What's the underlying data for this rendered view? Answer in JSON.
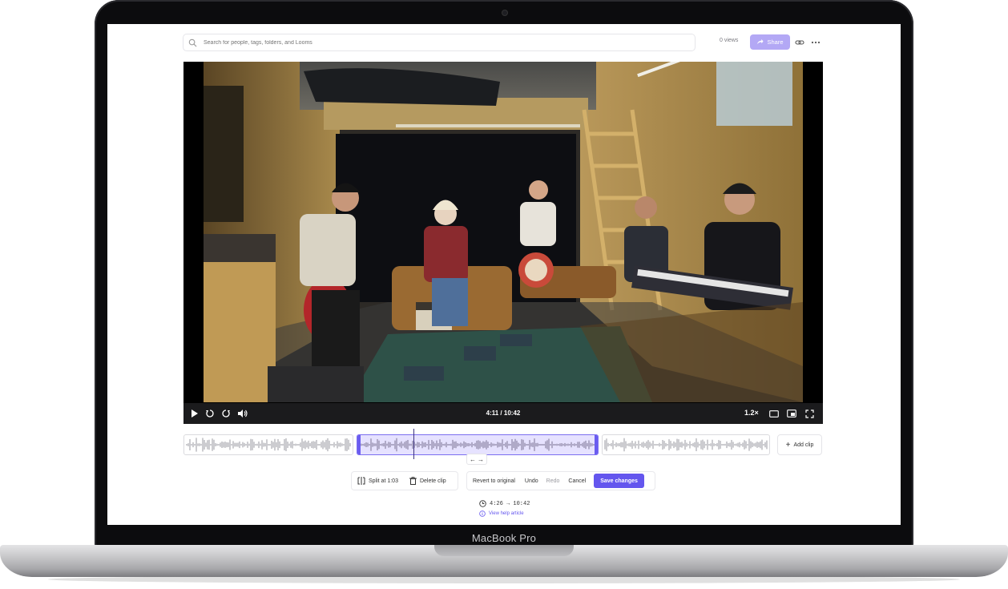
{
  "device": {
    "brand_label": "MacBook Pro"
  },
  "header": {
    "search_placeholder": "Search for people, tags, folders, and Looms",
    "views_label": "0 views",
    "share_label": "Share"
  },
  "player": {
    "current_time": "4:11",
    "duration": "10:42",
    "time_display": "4:11 / 10:42",
    "playback_rate": "1.2×",
    "progress_fraction": 0.39
  },
  "timeline": {
    "add_clip_label": "Add clip",
    "arrow_left": "←",
    "arrow_right": "→"
  },
  "toolbar": {
    "split_label": "Split at 1:03",
    "delete_label": "Delete clip",
    "revert_label": "Revert to original",
    "undo_label": "Undo",
    "redo_label": "Redo",
    "cancel_label": "Cancel",
    "save_label": "Save changes"
  },
  "trim": {
    "range_label": "4:26 → 10:42",
    "help_label": "View help article"
  },
  "colors": {
    "accent": "#6456ee",
    "share_bg": "#b3a8f5",
    "clip_active_bg": "#e6e2ff"
  }
}
